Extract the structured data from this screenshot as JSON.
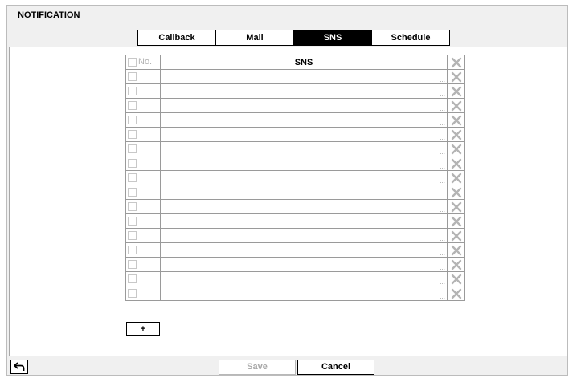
{
  "page": {
    "title": "NOTIFICATION"
  },
  "tabs": [
    {
      "label": "Callback",
      "active": false
    },
    {
      "label": "Mail",
      "active": false
    },
    {
      "label": "SNS",
      "active": true
    },
    {
      "label": "Schedule",
      "active": false
    }
  ],
  "table": {
    "header": {
      "no_label": "No.",
      "sns_label": "SNS",
      "delete_icon": "x-icon"
    },
    "row_count": 16,
    "rows": [
      {
        "sns": ""
      },
      {
        "sns": ""
      },
      {
        "sns": ""
      },
      {
        "sns": ""
      },
      {
        "sns": ""
      },
      {
        "sns": ""
      },
      {
        "sns": ""
      },
      {
        "sns": ""
      },
      {
        "sns": ""
      },
      {
        "sns": ""
      },
      {
        "sns": ""
      },
      {
        "sns": ""
      },
      {
        "sns": ""
      },
      {
        "sns": ""
      },
      {
        "sns": ""
      },
      {
        "sns": ""
      }
    ],
    "more_icon": "..."
  },
  "add_button": {
    "label": "+"
  },
  "footer": {
    "back_icon": "back-arrow-icon",
    "save_label": "Save",
    "save_enabled": false,
    "cancel_label": "Cancel"
  },
  "colors": {
    "active_tab_bg": "#000000",
    "disabled_text": "#a8a8a8",
    "icon_gray": "#b4b4b4"
  }
}
